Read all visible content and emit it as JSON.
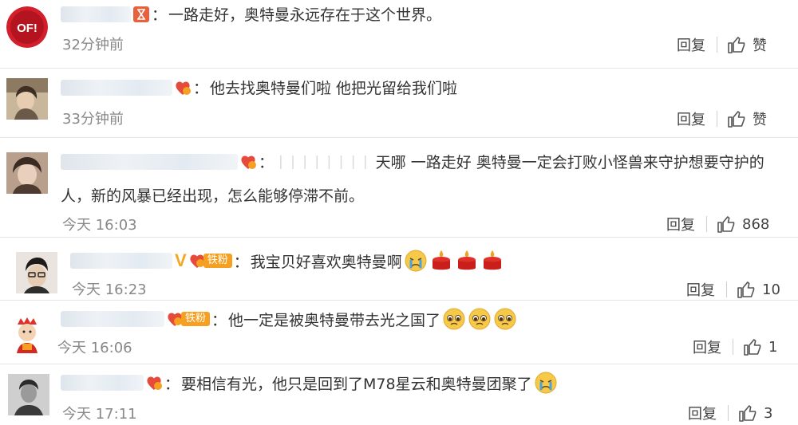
{
  "comments": [
    {
      "text": "一路走好，奥特曼永远存在于这个世界。",
      "time": "32分钟前",
      "reply_label": "回复",
      "like_label": "赞"
    },
    {
      "text": "他去找奥特曼们啦 他把光留给我们啦",
      "time": "33分钟前",
      "reply_label": "回复",
      "like_label": "赞"
    },
    {
      "text_line1": "天哪 一路走好 奥特曼一定会打败小怪兽来守护想要守护的",
      "text_line2": "人，新的风暴已经出现，怎么能够停滞不前。",
      "time": "今天 16:03",
      "reply_label": "回复",
      "like_count": "868"
    },
    {
      "badge_label": "铁粉",
      "text": "我宝贝好喜欢奥特曼啊",
      "time": "今天 16:23",
      "reply_label": "回复",
      "like_count": "10"
    },
    {
      "badge_label": "铁粉",
      "text": "他一定是被奥特曼带去光之国了",
      "time": "今天 16:06",
      "reply_label": "回复",
      "like_count": "1"
    },
    {
      "text": "要相信有光，他只是回到了M78星云和奥特曼团聚了",
      "time": "今天 17:11",
      "reply_label": "回复",
      "like_count": "3"
    }
  ],
  "colors": {
    "badge_orange": "#f5a021",
    "divider": "#e6e6e6",
    "time_gray": "#888888",
    "text": "#333333"
  },
  "icons": {
    "like": "thumbs-up-icon",
    "hourglass": "hourglass-icon",
    "level_badge": "heart-level-icon",
    "vip": "vip-v-icon",
    "emoji_crying": "crying-face-icon",
    "emoji_candle": "candle-icon",
    "emoji_pleading": "pleading-face-icon"
  }
}
